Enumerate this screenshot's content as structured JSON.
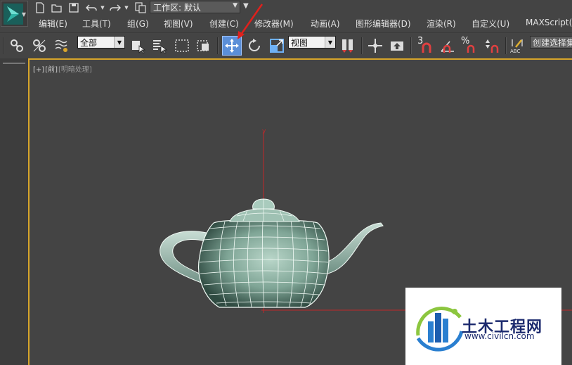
{
  "quick_access": {
    "workspace_label": "工作区: 默认"
  },
  "menus": [
    {
      "label": "编辑(E)"
    },
    {
      "label": "工具(T)"
    },
    {
      "label": "组(G)"
    },
    {
      "label": "视图(V)"
    },
    {
      "label": "创建(C)"
    },
    {
      "label": "修改器(M)"
    },
    {
      "label": "动画(A)"
    },
    {
      "label": "图形编辑器(D)"
    },
    {
      "label": "渲染(R)"
    },
    {
      "label": "自定义(U)"
    },
    {
      "label": "MAXScript(X"
    }
  ],
  "toolbar": {
    "selection_filter": "全部",
    "ref_coord_system": "视图",
    "snap_value": "3",
    "named_selection_set": "创建选择集"
  },
  "viewport": {
    "label_plus": "[+]",
    "label_view": "[前]",
    "label_shading": "[明暗处理]",
    "axis_y": "y",
    "active_border_color": "#d7a52a",
    "grid_axis_color": "#c0282a"
  },
  "watermark": {
    "title": "土木工程网",
    "url": "www.civilcn.com"
  },
  "annotation": {
    "arrow_color": "#e0201c"
  }
}
